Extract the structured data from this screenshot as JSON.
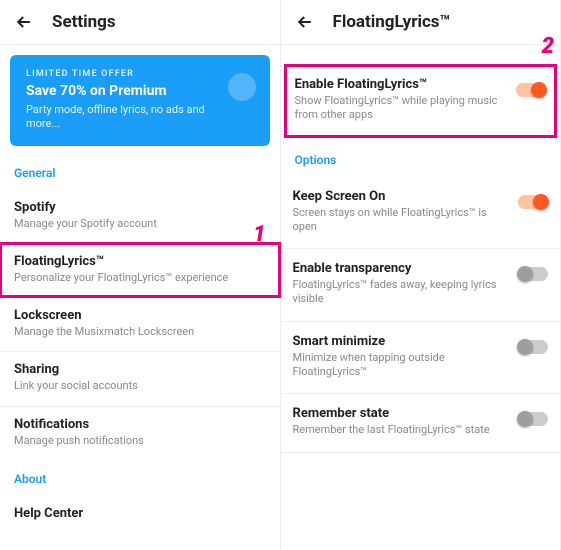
{
  "left": {
    "header_title": "Settings",
    "promo": {
      "label": "LIMITED TIME OFFER",
      "title": "Save 70% on Premium",
      "subtitle": "Party mode, offline lyrics, no ads and more..."
    },
    "section_general": "General",
    "items": [
      {
        "title": "Spotify",
        "subtitle": "Manage your Spotify account"
      },
      {
        "title": "FloatingLyrics™",
        "subtitle": "Personalize your FloatingLyrics™ experience"
      },
      {
        "title": "Lockscreen",
        "subtitle": "Manage the Musixmatch Lockscreen"
      },
      {
        "title": "Sharing",
        "subtitle": "Link your social accounts"
      },
      {
        "title": "Notifications",
        "subtitle": "Manage push notifications"
      }
    ],
    "section_about": "About",
    "help_center": "Help Center"
  },
  "right": {
    "header_title": "FloatingLyrics™",
    "enable": {
      "title": "Enable FloatingLyrics™",
      "subtitle": "Show FloatingLyrics™ while playing music from other apps"
    },
    "section_options": "Options",
    "options": [
      {
        "title": "Keep Screen On",
        "subtitle": "Screen stays on while FloatingLyrics™ is open",
        "on": true
      },
      {
        "title": "Enable transparency",
        "subtitle": "FloatingLyrics™ fades away, keeping lyrics visible",
        "on": false
      },
      {
        "title": "Smart minimize",
        "subtitle": "Minimize when tapping outside FloatingLyrics™",
        "on": false
      },
      {
        "title": "Remember state",
        "subtitle": "Remember the last FloatingLyrics™ state",
        "on": false
      }
    ]
  },
  "annotations": {
    "one": "1",
    "two": "2"
  }
}
